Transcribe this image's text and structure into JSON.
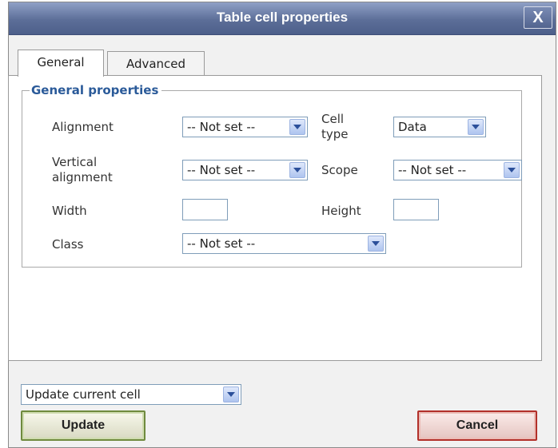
{
  "dialog": {
    "title": "Table cell properties",
    "close_label": "X"
  },
  "tabs": [
    {
      "label": "General",
      "active": true
    },
    {
      "label": "Advanced",
      "active": false
    }
  ],
  "general": {
    "legend": "General properties",
    "alignment": {
      "label": "Alignment",
      "value": "-- Not set --"
    },
    "cell_type": {
      "label_line1": "Cell",
      "label_line2": "type",
      "value": "Data"
    },
    "vertical_alignment": {
      "label_line1": "Vertical",
      "label_line2": "alignment",
      "value": "-- Not set --"
    },
    "scope": {
      "label": "Scope",
      "value": "-- Not set --"
    },
    "width": {
      "label": "Width",
      "value": ""
    },
    "height": {
      "label": "Height",
      "value": ""
    },
    "class": {
      "label": "Class",
      "value": "-- Not set --"
    }
  },
  "action_select": {
    "value": "Update current cell"
  },
  "buttons": {
    "update": "Update",
    "cancel": "Cancel"
  },
  "colors": {
    "titlebar": "#5c6e98",
    "legend": "#2a5a99",
    "update_border": "#6f8a3e",
    "cancel_border": "#b2302a"
  }
}
